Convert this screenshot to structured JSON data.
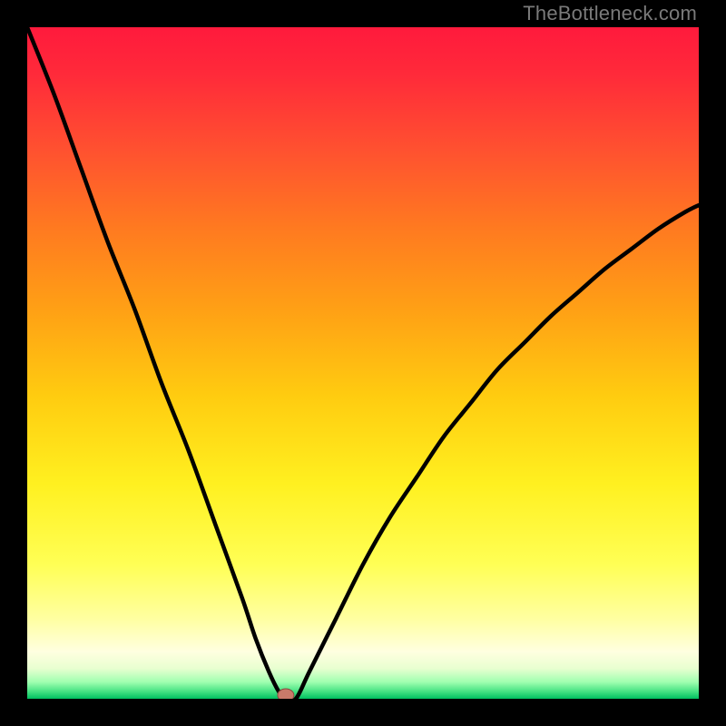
{
  "watermark": "TheBottleneck.com",
  "colors": {
    "background": "#000000",
    "gradient_stops": [
      {
        "offset": 0.0,
        "color": "#ff1a3c"
      },
      {
        "offset": 0.07,
        "color": "#ff2a3a"
      },
      {
        "offset": 0.18,
        "color": "#ff5030"
      },
      {
        "offset": 0.3,
        "color": "#ff7a20"
      },
      {
        "offset": 0.42,
        "color": "#ffa015"
      },
      {
        "offset": 0.55,
        "color": "#ffcc10"
      },
      {
        "offset": 0.68,
        "color": "#fff020"
      },
      {
        "offset": 0.8,
        "color": "#ffff55"
      },
      {
        "offset": 0.88,
        "color": "#ffffa0"
      },
      {
        "offset": 0.93,
        "color": "#ffffe0"
      },
      {
        "offset": 0.955,
        "color": "#e8ffd0"
      },
      {
        "offset": 0.975,
        "color": "#a0ffb0"
      },
      {
        "offset": 0.99,
        "color": "#40e080"
      },
      {
        "offset": 1.0,
        "color": "#00c060"
      }
    ],
    "curve": "#000000",
    "marker_fill": "#c97a6a",
    "marker_stroke": "#8a4a3e"
  },
  "chart_data": {
    "type": "line",
    "title": "",
    "xlabel": "",
    "ylabel": "",
    "xlim": [
      0,
      100
    ],
    "ylim": [
      0,
      100
    ],
    "note": "V-shaped bottleneck curve; x in percent across plot width, y = bottleneck % (0 at green bottom, 100 at red top). Values estimated from pixels.",
    "series": [
      {
        "name": "bottleneck-curve",
        "x": [
          0,
          4,
          8,
          12,
          16,
          20,
          24,
          28,
          32,
          34,
          36,
          37.5,
          38.5,
          40,
          42,
          46,
          50,
          54,
          58,
          62,
          66,
          70,
          74,
          78,
          82,
          86,
          90,
          94,
          98,
          100
        ],
        "y": [
          100,
          90,
          79,
          68,
          58,
          47,
          37,
          26,
          15,
          9,
          4,
          1,
          0,
          0,
          4,
          12,
          20,
          27,
          33,
          39,
          44,
          49,
          53,
          57,
          60.5,
          64,
          67,
          70,
          72.5,
          73.5
        ]
      }
    ],
    "marker": {
      "x_pct": 38.5,
      "y_pct": 0
    }
  }
}
